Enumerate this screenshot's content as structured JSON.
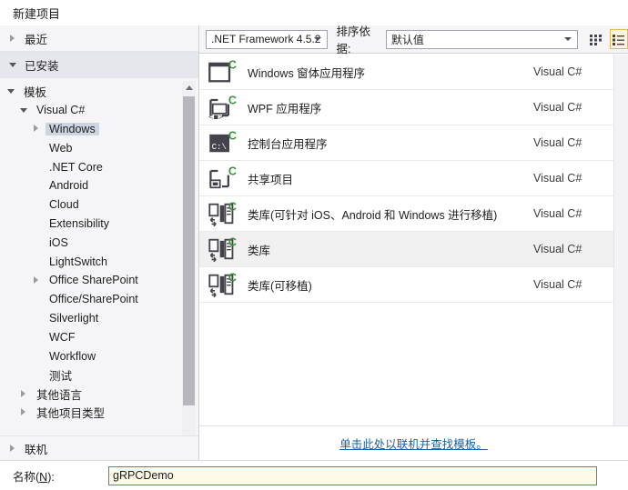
{
  "window": {
    "title": "新建项目"
  },
  "sidebar": {
    "groups": [
      {
        "label": "最近",
        "state": "collapsed"
      },
      {
        "label": "已安装",
        "state": "expanded"
      }
    ],
    "tree": [
      {
        "label": "模板",
        "indent": 0,
        "twisty": "expanded",
        "selected": false
      },
      {
        "label": "Visual C#",
        "indent": 1,
        "twisty": "expanded",
        "selected": false
      },
      {
        "label": "Windows",
        "indent": 2,
        "twisty": "collapsed",
        "selected": true
      },
      {
        "label": "Web",
        "indent": 2,
        "twisty": "none",
        "selected": false
      },
      {
        "label": ".NET Core",
        "indent": 2,
        "twisty": "none",
        "selected": false
      },
      {
        "label": "Android",
        "indent": 2,
        "twisty": "none",
        "selected": false
      },
      {
        "label": "Cloud",
        "indent": 2,
        "twisty": "none",
        "selected": false
      },
      {
        "label": "Extensibility",
        "indent": 2,
        "twisty": "none",
        "selected": false
      },
      {
        "label": "iOS",
        "indent": 2,
        "twisty": "none",
        "selected": false
      },
      {
        "label": "LightSwitch",
        "indent": 2,
        "twisty": "none",
        "selected": false
      },
      {
        "label": "Office SharePoint",
        "indent": 2,
        "twisty": "collapsed",
        "selected": false
      },
      {
        "label": "Office/SharePoint",
        "indent": 2,
        "twisty": "none",
        "selected": false
      },
      {
        "label": "Silverlight",
        "indent": 2,
        "twisty": "none",
        "selected": false
      },
      {
        "label": "WCF",
        "indent": 2,
        "twisty": "none",
        "selected": false
      },
      {
        "label": "Workflow",
        "indent": 2,
        "twisty": "none",
        "selected": false
      },
      {
        "label": "测试",
        "indent": 2,
        "twisty": "none",
        "selected": false
      },
      {
        "label": "其他语言",
        "indent": 1,
        "twisty": "collapsed",
        "selected": false
      },
      {
        "label": "其他项目类型",
        "indent": 1,
        "twisty": "collapsed",
        "selected": false
      }
    ],
    "online": {
      "label": "联机",
      "twisty": "collapsed"
    }
  },
  "toolbar": {
    "framework": {
      "value": ".NET Framework 4.5.2"
    },
    "sort_label": "排序依据:",
    "sort": {
      "value": "默认值"
    },
    "grid_view_title": "grid-view",
    "list_view_title": "list-view",
    "list_view_active": true,
    "accent_selected": "#e0bb55"
  },
  "templates": {
    "lang_column": "Visual C#",
    "rows": [
      {
        "name": "Windows 窗体应用程序",
        "lang": "Visual C#",
        "icon": "winforms-icon",
        "selected": false
      },
      {
        "name": "WPF 应用程序",
        "lang": "Visual C#",
        "icon": "wpf-icon",
        "selected": false
      },
      {
        "name": "控制台应用程序",
        "lang": "Visual C#",
        "icon": "console-icon",
        "selected": false
      },
      {
        "name": "共享项目",
        "lang": "Visual C#",
        "icon": "shared-icon",
        "selected": false
      },
      {
        "name": "类库(可针对 iOS、Android 和 Windows 进行移植)",
        "lang": "Visual C#",
        "icon": "portable-lib-icon",
        "selected": false
      },
      {
        "name": "类库",
        "lang": "Visual C#",
        "icon": "classlib-icon",
        "selected": true
      },
      {
        "name": "类库(可移植)",
        "lang": "Visual C#",
        "icon": "portable-lib-icon",
        "selected": false
      }
    ]
  },
  "footer": {
    "online_templates_link": "单击此处以联机并查找模板。"
  },
  "name_field": {
    "label_prefix": "名称(",
    "label_accel": "N",
    "label_suffix": "):",
    "value": "gRPCDemo",
    "placeholder": ""
  }
}
